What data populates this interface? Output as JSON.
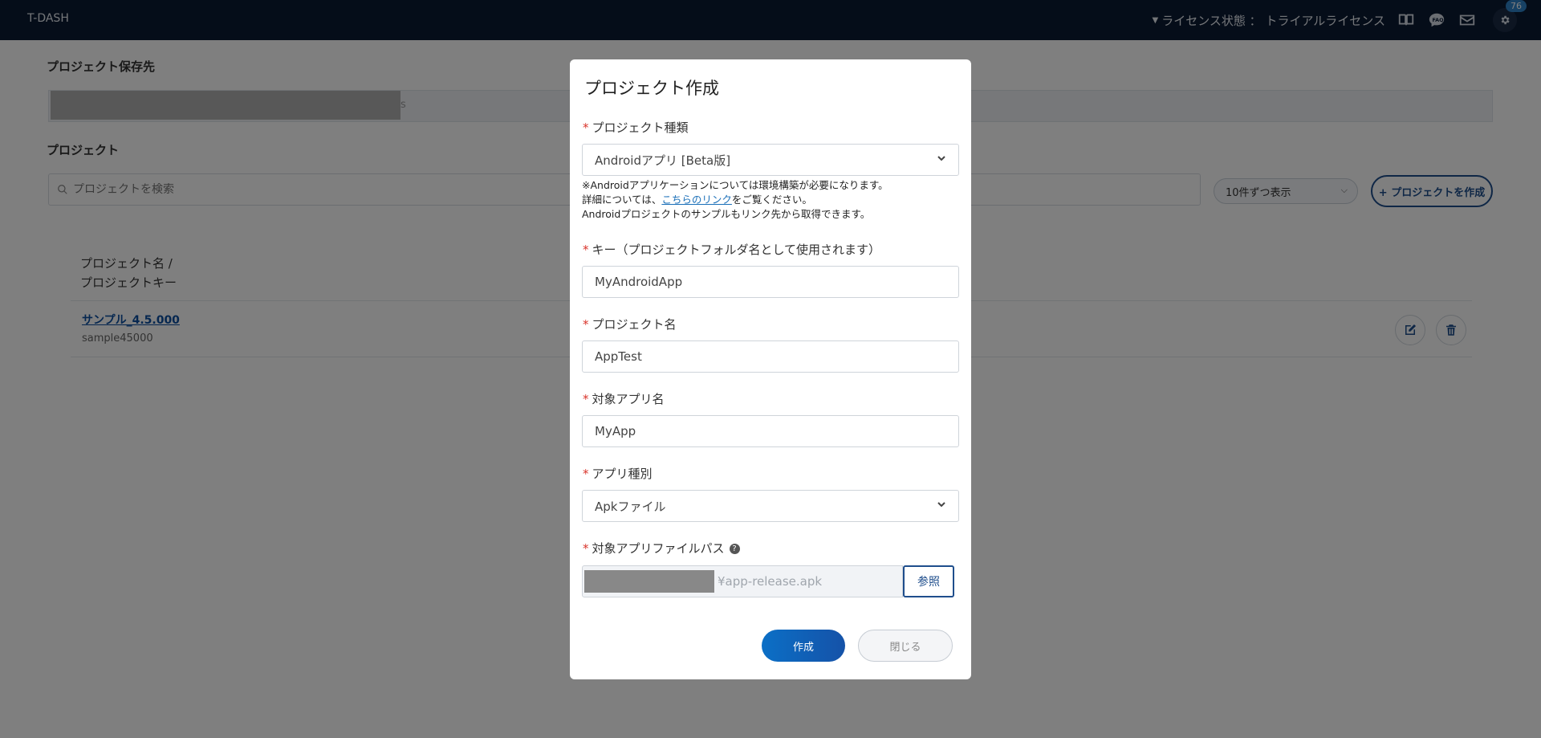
{
  "app": {
    "brand": "T-DASH"
  },
  "header": {
    "license_label": "ライセンス状態 ： トライアルライセンス",
    "badge_count": "76",
    "icons": [
      "book-icon",
      "faq-icon",
      "mail-icon",
      "gear-icon"
    ]
  },
  "page": {
    "save_label": "プロジェクト保存先",
    "save_path_tail": "s",
    "projects_label": "プロジェクト",
    "search_placeholder": "プロジェクトを検索",
    "per_page": "10件ずつ表示",
    "create_project": "+ プロジェクトを作成",
    "table_header_line1": "プロジェクト名 /",
    "table_header_line2": "プロジェクトキー",
    "rows": [
      {
        "name": "サンプル_4.5.000",
        "key": "sample45000"
      }
    ]
  },
  "modal": {
    "title": "プロジェクト作成",
    "type_label": "プロジェクト種類",
    "type_value": "Androidアプリ [Beta版]",
    "note_line1": "※Androidアプリケーションについては環境構築が必要になります。",
    "note_line2_pre": "詳細については、",
    "note_line2_link": "こちらのリンク",
    "note_line2_post": "をご覧ください。",
    "note_line3": "Androidプロジェクトのサンプルもリンク先から取得できます。",
    "key_label": "キー（プロジェクトフォルダ名として使用されます）",
    "key_value": "MyAndroidApp",
    "name_label": "プロジェクト名",
    "name_value": "AppTest",
    "app_name_label": "対象アプリ名",
    "app_name_value": "MyApp",
    "app_type_label": "アプリ種別",
    "app_type_value": "Apkファイル",
    "app_path_label": "対象アプリファイルパス",
    "app_path_tail": "¥app-release.apk",
    "browse_label": "参照",
    "create_label": "作成",
    "close_label": "閉じる",
    "required_mark": "*"
  },
  "colors": {
    "header_bg": "#0b1a33",
    "primary": "#1f4e8c",
    "required": "#d9342b",
    "link": "#1a6fb8"
  }
}
